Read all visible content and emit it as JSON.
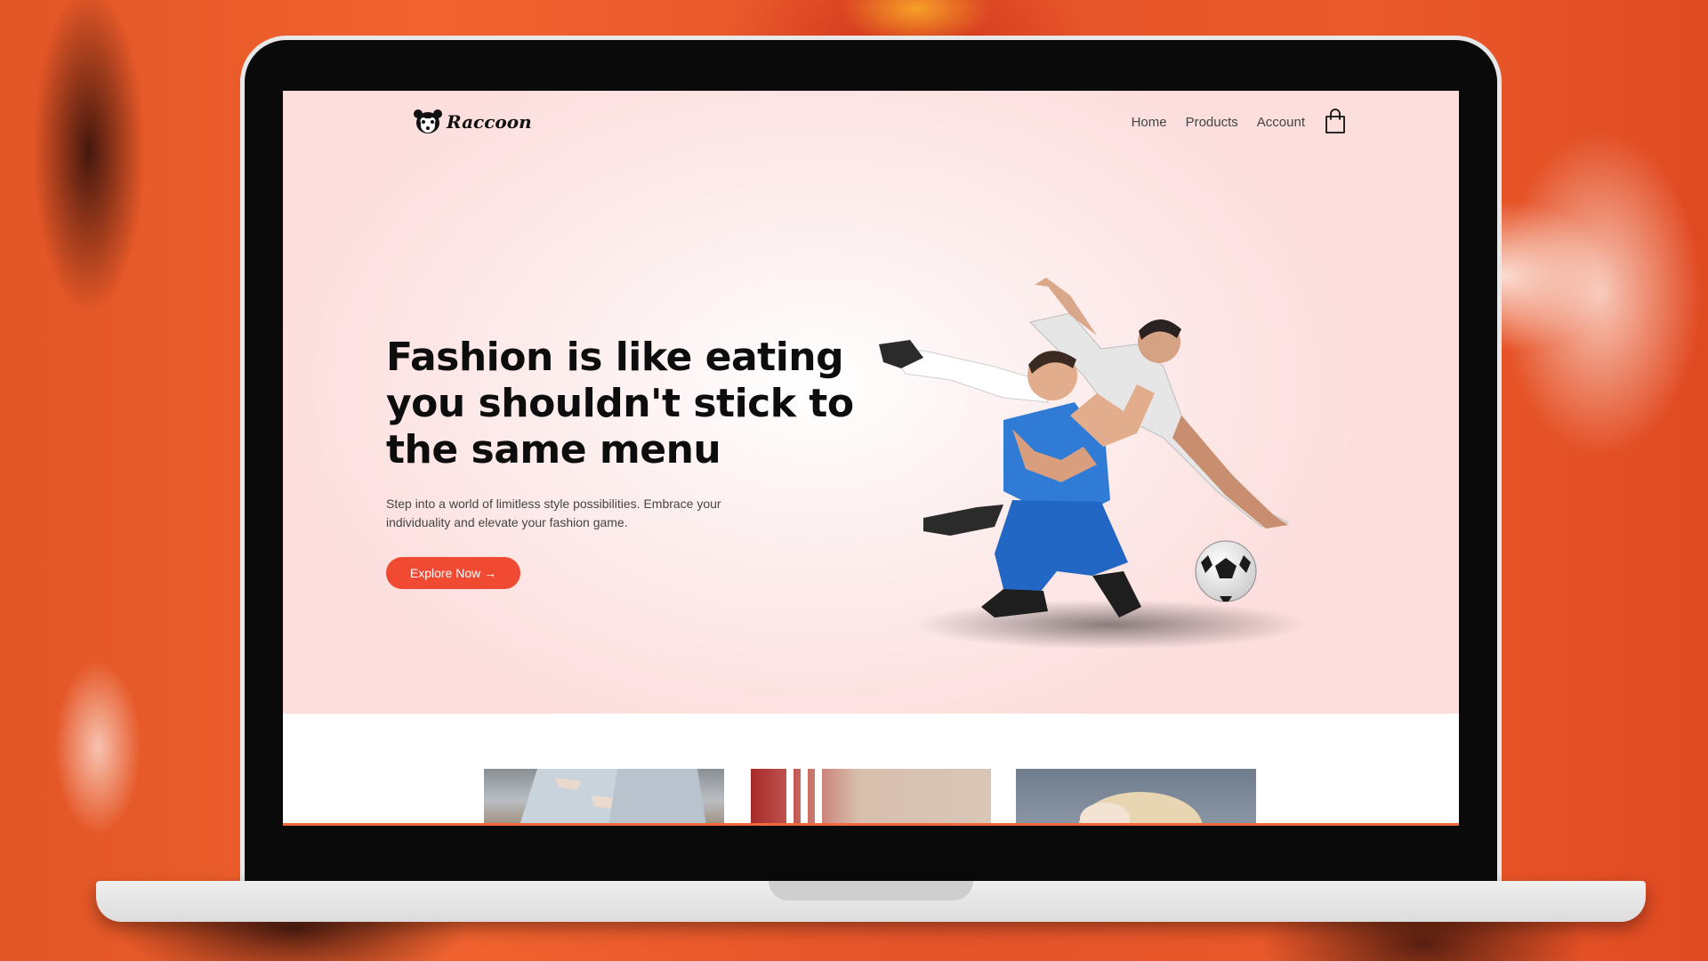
{
  "brand": {
    "name": "Raccoon"
  },
  "nav": {
    "links": [
      "Home",
      "Products",
      "Account"
    ],
    "cart_icon": "shopping-bag-icon"
  },
  "hero": {
    "title": "Fashion is like eating you shouldn't stick to the same menu",
    "subtitle": "Step into a world of limitless style possibilities. Embrace your individuality and elevate your fashion game.",
    "cta": "Explore Now →",
    "image": "soccer-players-celebration"
  },
  "products": {
    "thumbnails": [
      "ripped-jeans-photo",
      "striped-track-pants-photo",
      "blonde-woman-photo"
    ]
  },
  "colors": {
    "accent": "#f04a32",
    "hero_bg": "#fcdedd",
    "text_dark": "#0d0d0d"
  }
}
